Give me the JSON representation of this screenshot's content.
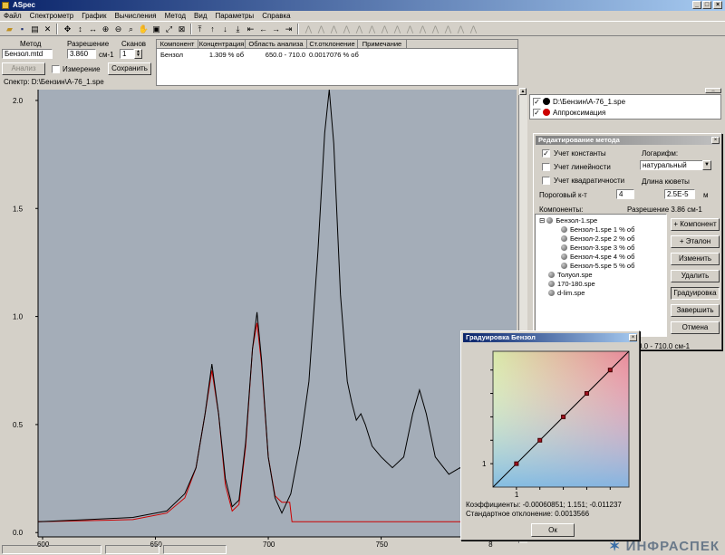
{
  "window": {
    "title": "ASpec"
  },
  "menu": [
    "Файл",
    "Спектрометр",
    "График",
    "Вычисления",
    "Метод",
    "Вид",
    "Параметры",
    "Справка"
  ],
  "method_panel": {
    "method_label": "Метод",
    "method_value": "Бензол.mtd",
    "resolution_label": "Разрешение",
    "resolution_value": "3.860",
    "resolution_unit": "см-1",
    "scans_label": "Сканов",
    "scans_value": "1",
    "analysis_button": "Анализ",
    "measure_label": "Измерение",
    "save_button": "Сохранить",
    "spectrum_path": "Спектр: D:\\Бензин\\А-76_1.spe"
  },
  "results_table": {
    "columns": [
      "Компонент",
      "Концентрация",
      "Область анализа",
      "Ст.отклонение",
      "Примечание"
    ],
    "rows": [
      [
        "Бензол",
        "1.309 % об",
        "650.0 - 710.0",
        "0.0017076 % об",
        ""
      ]
    ]
  },
  "spectra_list": [
    {
      "name": "D:\\Бензин\\А-76_1.spe",
      "color": "#000000",
      "checked": true
    },
    {
      "name": "Аппроксимация",
      "color": "#cc0000",
      "checked": true
    }
  ],
  "chart_data": {
    "type": "line",
    "xlim": [
      598,
      810
    ],
    "ylim": [
      -0.02,
      2.05
    ],
    "x_ticks": [
      600,
      650,
      700,
      750,
      800
    ],
    "y_ticks": [
      0.0,
      0.5,
      1.0,
      1.5,
      2.0
    ],
    "x_tick_labels": [
      "600",
      "650",
      "700",
      "750",
      "8"
    ],
    "y_tick_labels": [
      "0.0",
      "0.5",
      "1.0",
      "1.5",
      "2.0"
    ],
    "background": "#a4adb8",
    "series": [
      {
        "name": "D:\\Бензин\\А-76_1.spe",
        "color": "#000000",
        "x": [
          598,
          620,
          640,
          655,
          663,
          668,
          672,
          675,
          678,
          681,
          684,
          687,
          690,
          693,
          695,
          697,
          700,
          703,
          706,
          710,
          714,
          718,
          722,
          725,
          727,
          729,
          732,
          735,
          737,
          739,
          741,
          743,
          746,
          750,
          755,
          760,
          764,
          767,
          770,
          774,
          780,
          785,
          790,
          795,
          798,
          802,
          806,
          810
        ],
        "y": [
          0.05,
          0.06,
          0.07,
          0.1,
          0.18,
          0.3,
          0.55,
          0.78,
          0.55,
          0.25,
          0.12,
          0.15,
          0.42,
          0.85,
          1.02,
          0.8,
          0.35,
          0.16,
          0.09,
          0.18,
          0.4,
          0.7,
          1.3,
          1.85,
          2.05,
          1.8,
          1.1,
          0.7,
          0.6,
          0.52,
          0.55,
          0.5,
          0.4,
          0.35,
          0.3,
          0.35,
          0.55,
          0.66,
          0.55,
          0.35,
          0.27,
          0.3,
          0.22,
          0.25,
          0.18,
          0.22,
          0.17,
          0.1
        ]
      },
      {
        "name": "Аппроксимация",
        "color": "#cc0000",
        "x": [
          598,
          640,
          655,
          663,
          668,
          672,
          675,
          678,
          681,
          684,
          687,
          690,
          693,
          695,
          697,
          700,
          703,
          706,
          709.5,
          710.5,
          760,
          810
        ],
        "y": [
          0.05,
          0.06,
          0.09,
          0.16,
          0.3,
          0.55,
          0.75,
          0.55,
          0.22,
          0.1,
          0.13,
          0.4,
          0.85,
          0.97,
          0.78,
          0.35,
          0.17,
          0.14,
          0.14,
          0.05,
          0.05,
          0.05
        ]
      }
    ]
  },
  "edit_method_dialog": {
    "title": "Редактирование метода",
    "const_label": "Учет константы",
    "const_checked": true,
    "linear_label": "Учет линейности",
    "linear_checked": false,
    "quad_label": "Учет квадратичности",
    "quad_checked": false,
    "log_label": "Логарифм:",
    "log_value": "натуральный",
    "threshold_label": "Пороговый к-т",
    "threshold_value": "4",
    "cell_length_label": "Длина кюветы",
    "cell_length_value": "2.5E-5",
    "cell_length_unit": "м",
    "components_label": "Компоненты:",
    "resolution_text": "Разрешение  3.86 см-1",
    "range_text": "0.0 - 710.0 см-1",
    "tree": [
      {
        "label": "Бензол-1.spe",
        "level": 0
      },
      {
        "label": "Бензол-1.spe 1 % об",
        "level": 1
      },
      {
        "label": "Бензол-2.spe 2 % об",
        "level": 1
      },
      {
        "label": "Бензол-3.spe 3 % об",
        "level": 1
      },
      {
        "label": "Бензол-4.spe 4 % об",
        "level": 1
      },
      {
        "label": "Бензол-5.spe 5 % об",
        "level": 1
      },
      {
        "label": "Толуол.spe",
        "level": 0
      },
      {
        "label": "170-180.spe",
        "level": 0
      },
      {
        "label": "d-lim.spe",
        "level": 0
      }
    ],
    "buttons": [
      "+ Компонент",
      "+ Эталон",
      "Изменить",
      "Удалить",
      "Градуировка",
      "Завершить",
      "Отмена"
    ]
  },
  "calibration_dialog": {
    "title": "Градуировка Бензол",
    "coef_text": "Коэффициенты: -0.00060851; 1.151; -0.011237",
    "stddev_text": "Стандартное отклонение: 0.0013566",
    "ok_button": "Ок",
    "x_tick_label": "1",
    "y_tick_label": "1",
    "points": [
      [
        1,
        1
      ],
      [
        2,
        2
      ],
      [
        3,
        3
      ],
      [
        4,
        4
      ],
      [
        5,
        5
      ]
    ],
    "axis_max": 5.8
  },
  "watermark": "ИНФРАСПЕК"
}
